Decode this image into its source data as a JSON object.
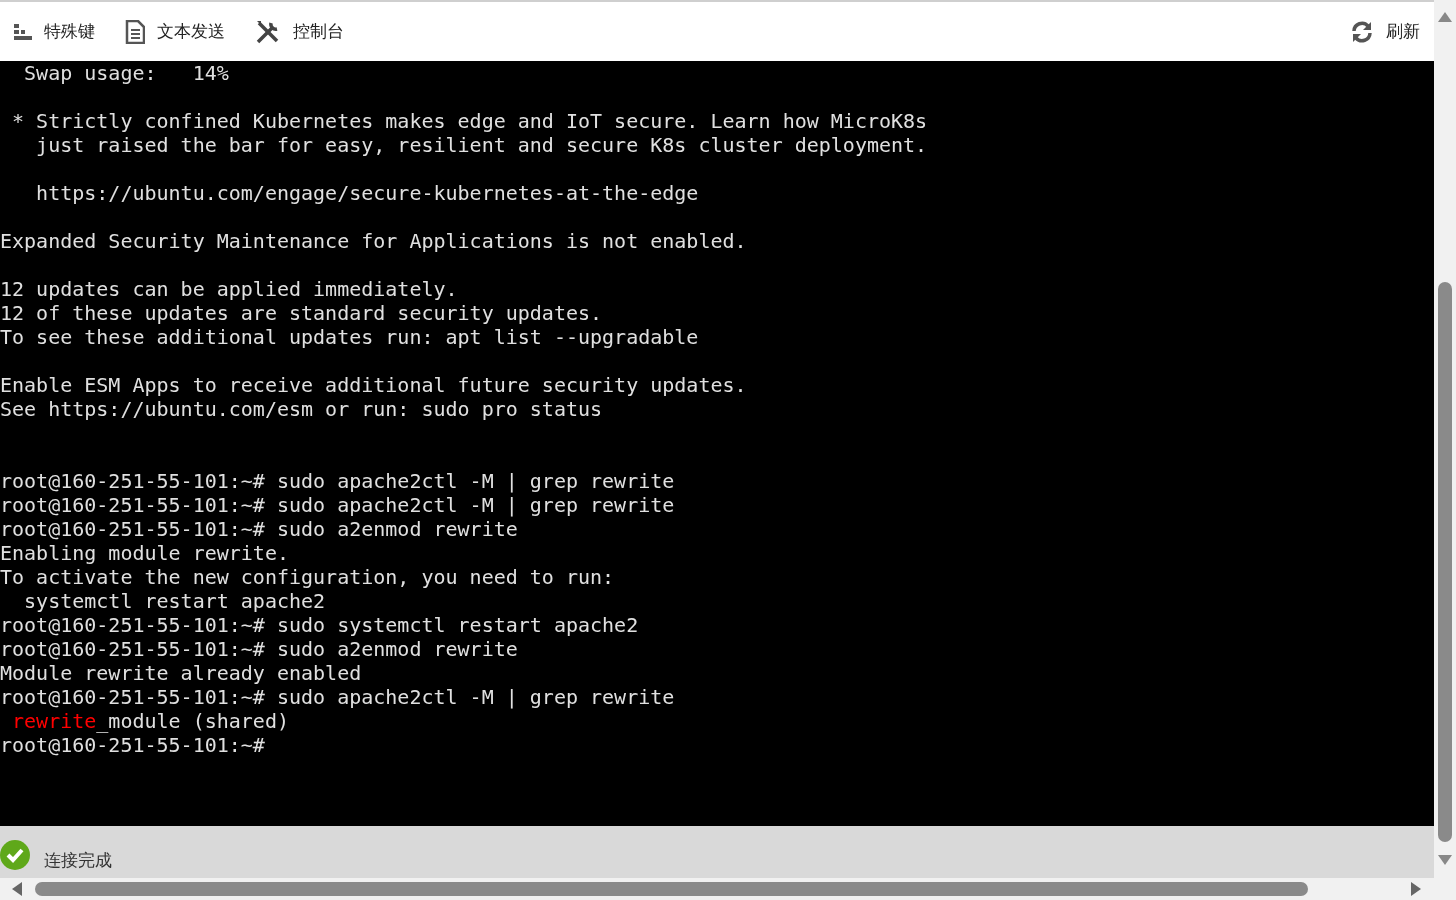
{
  "toolbar": {
    "left": [
      {
        "kind": "keys",
        "label": "特殊键"
      },
      {
        "kind": "document",
        "label": "文本发送"
      },
      {
        "kind": "tools",
        "label": "控制台"
      }
    ],
    "right": [
      {
        "kind": "refresh",
        "label": "刷新"
      }
    ]
  },
  "terminal": {
    "lines": [
      {
        "text": "  Swap usage:   14%"
      },
      {
        "kind": "blank"
      },
      {
        "text": " * Strictly confined Kubernetes makes edge and IoT secure. Learn how MicroK8s"
      },
      {
        "text": "   just raised the bar for easy, resilient and secure K8s cluster deployment."
      },
      {
        "kind": "blank"
      },
      {
        "text": "   https://ubuntu.com/engage/secure-kubernetes-at-the-edge"
      },
      {
        "kind": "blank"
      },
      {
        "text": "Expanded Security Maintenance for Applications is not enabled."
      },
      {
        "kind": "blank"
      },
      {
        "text": "12 updates can be applied immediately."
      },
      {
        "text": "12 of these updates are standard security updates."
      },
      {
        "text": "To see these additional updates run: apt list --upgradable"
      },
      {
        "kind": "blank"
      },
      {
        "text": "Enable ESM Apps to receive additional future security updates."
      },
      {
        "text": "See https://ubuntu.com/esm or run: sudo pro status"
      },
      {
        "kind": "blank"
      },
      {
        "kind": "blank"
      },
      {
        "text": "root@160-251-55-101:~# sudo apache2ctl -M | grep rewrite"
      },
      {
        "text": "root@160-251-55-101:~# sudo apache2ctl -M | grep rewrite"
      },
      {
        "text": "root@160-251-55-101:~# sudo a2enmod rewrite"
      },
      {
        "text": "Enabling module rewrite."
      },
      {
        "text": "To activate the new configuration, you need to run:"
      },
      {
        "text": "  systemctl restart apache2"
      },
      {
        "text": "root@160-251-55-101:~# sudo systemctl restart apache2"
      },
      {
        "text": "root@160-251-55-101:~# sudo a2enmod rewrite"
      },
      {
        "text": "Module rewrite already enabled"
      },
      {
        "text": "root@160-251-55-101:~# sudo apache2ctl -M | grep rewrite"
      },
      {
        "kind": "parts",
        "parts": [
          {
            "text": " rewrite",
            "color": "#ff0000"
          },
          {
            "text": "_module (shared)",
            "color": "#e0e0e0"
          }
        ]
      },
      {
        "text": "root@160-251-55-101:~#"
      }
    ]
  },
  "status": {
    "kind": "success",
    "text": "连接完成"
  }
}
